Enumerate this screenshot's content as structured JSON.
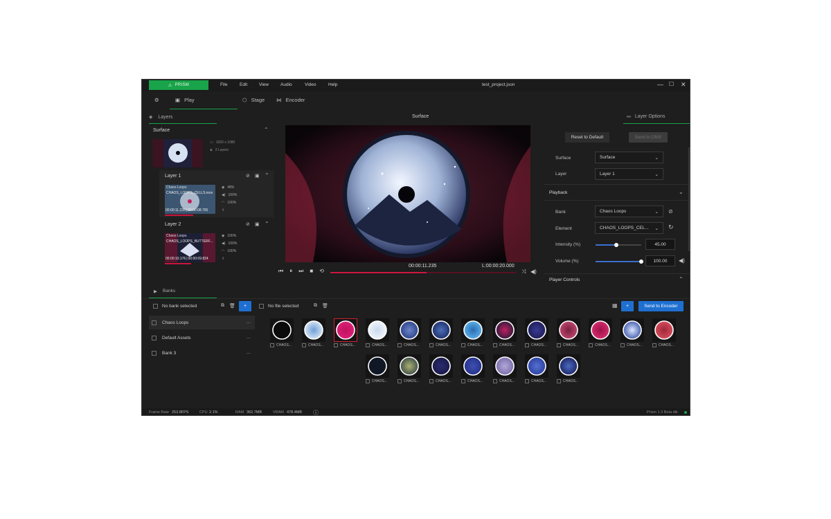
{
  "app": {
    "brand": "PRISM",
    "menu": [
      "File",
      "Edit",
      "View",
      "Audio",
      "Video",
      "Help"
    ],
    "window_title": "test_project.json",
    "accent": "#19a34a"
  },
  "modes": {
    "play": "Play",
    "stage": "Stage",
    "encoder": "Encoder"
  },
  "layers_panel": {
    "tab": "Layers",
    "surface": {
      "title": "Surface",
      "resolution": "1920 x 1080",
      "layers_count": "2 Layers"
    },
    "layers": [
      {
        "name": "Layer 1",
        "bank": "Chaos Loops",
        "element": "CHAOS_LOOPS_CELLS.mov",
        "opacity": "48%",
        "volume": "100%",
        "speed": "100%",
        "time_current": "00:00:11.235",
        "time_total": "00:00:08.765"
      },
      {
        "name": "Layer 2",
        "bank": "Chaos Loops",
        "element": "CHAOS_LOOPS_BUTTERF...",
        "opacity": "100%",
        "volume": "100%",
        "speed": "100%",
        "time_current": "00:00:10.176",
        "time_total": "00:00:09.824"
      }
    ]
  },
  "viewport": {
    "title": "Surface",
    "time_current": "00:00:11.235",
    "time_total": "L:00:00:20.000",
    "progress": 0.52
  },
  "layer_options": {
    "tab": "Layer Options",
    "reset_label": "Reset to Default",
    "send_label": "Send to DMX",
    "surface_label": "Surface",
    "surface_value": "Surface",
    "layer_label": "Layer",
    "layer_value": "Layer 1",
    "playback_label": "Playback",
    "bank_label": "Bank",
    "bank_value": "Chaos Loops",
    "element_label": "Element",
    "element_value": "CHAOS_LOOPS_CEL...",
    "intensity_label": "Intensity (%)",
    "intensity_value": "45.00",
    "intensity_fraction": 0.45,
    "volume_label": "Volume (%)",
    "volume_value": "100.00",
    "volume_fraction": 1.0,
    "player_controls_label": "Player Controls"
  },
  "banks": {
    "tab": "Banks",
    "no_bank": "No bank selected",
    "add": "+",
    "items": [
      "Chaos Loops",
      "Default Assets",
      "Bank 3"
    ],
    "more": "···"
  },
  "assets": {
    "no_file": "No file selected",
    "add": "+",
    "send_to_encoder": "Send to Encoder",
    "label": "CHAOS..."
  },
  "status": {
    "frame_rate_label": "Frame Rate",
    "frame_rate": "253.8FPS",
    "cpu_label": "CPU",
    "cpu": "2.1%",
    "ram_label": "RAM",
    "ram": "362.7MB",
    "vram_label": "VRAM",
    "vram": "478.4MB",
    "version": "Prism 1.3 Beta dik"
  }
}
